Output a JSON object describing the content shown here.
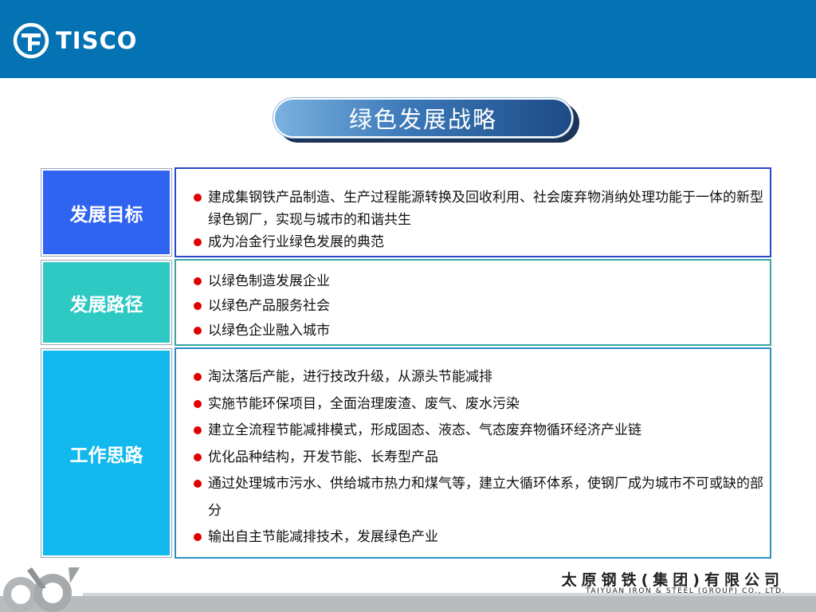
{
  "header": {
    "logo_text": "TISCO",
    "logo_icon": "tisco-logo-icon"
  },
  "slide": {
    "title": "绿色发展战略"
  },
  "sections": [
    {
      "label": "发展目标",
      "items": [
        "建成集钢铁产品制造、生产过程能源转换及回收利用、社会废弃物消纳处理功能于一体的新型绿色钢厂，实现与城市的和谐共生",
        "成为冶金行业绿色发展的典范"
      ]
    },
    {
      "label": "发展路径",
      "items": [
        "以绿色制造发展企业",
        "以绿色产品服务社会",
        "以绿色企业融入城市"
      ]
    },
    {
      "label": "工作思路",
      "items": [
        "淘汰落后产能，进行技改升级，从源头节能减排",
        "实施节能环保项目，全面治理废渣、废气、废水污染",
        "建立全流程节能减排模式，形成固态、液态、气态废弃物循环经济产业链",
        "优化品种结构，开发节能、长寿型产品",
        "通过处理城市污水、供给城市热力和煤气等，建立大循环体系，使钢厂成为城市不可或缺的部分",
        "输出自主节能减排技术，发展绿色产业"
      ]
    }
  ],
  "footer": {
    "company_cn": "太原钢铁(集团)有限公司",
    "company_en": "TAIYUAN IRON & STEEL (GROUP) CO., LTD.",
    "emblem_icon": "company-emblem-icon"
  },
  "colors": {
    "header": "#0573b3",
    "section1": "#2f63f0",
    "section2": "#2fc9c3",
    "section3": "#12b9ee",
    "bullet": "#e00000"
  }
}
